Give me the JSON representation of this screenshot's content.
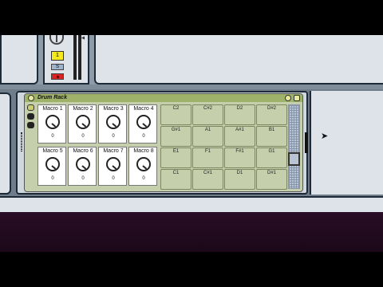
{
  "mixer": {
    "track_number": "1",
    "solo_label": "S"
  },
  "drum_rack": {
    "title": "Drum Rack",
    "macros": [
      {
        "label": "Macro 1",
        "value": "0"
      },
      {
        "label": "Macro 2",
        "value": "0"
      },
      {
        "label": "Macro 3",
        "value": "0"
      },
      {
        "label": "Macro 4",
        "value": "0"
      },
      {
        "label": "Macro 5",
        "value": "0"
      },
      {
        "label": "Macro 6",
        "value": "0"
      },
      {
        "label": "Macro 7",
        "value": "0"
      },
      {
        "label": "Macro 8",
        "value": "0"
      }
    ],
    "pads": [
      "C2",
      "C#2",
      "D2",
      "D#2",
      "G#1",
      "A1",
      "A#1",
      "B1",
      "E1",
      "F1",
      "F#1",
      "G1",
      "C1",
      "C#1",
      "D1",
      "D#1"
    ]
  },
  "colors": {
    "rack_header": "#9fb26a",
    "rack_body": "#c5cfab",
    "track_number_bg": "#f4ea1e",
    "arm_button": "#d92222"
  }
}
